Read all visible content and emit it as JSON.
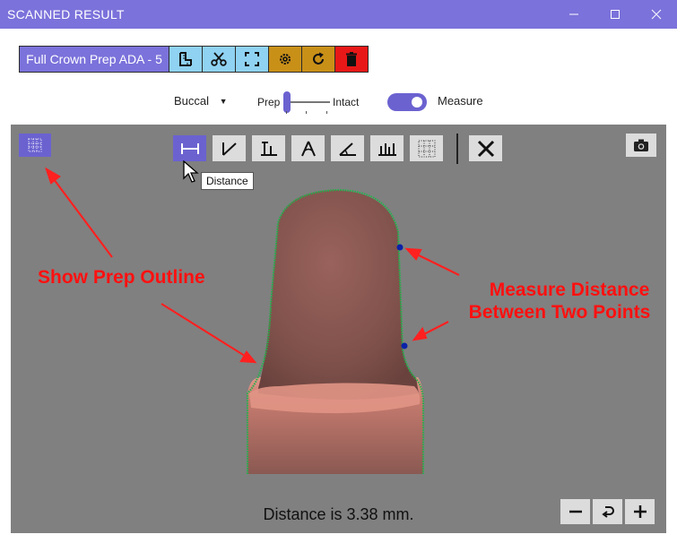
{
  "window": {
    "title": "SCANNED RESULT"
  },
  "toolbar": {
    "preset_label": "Full Crown Prep ADA - 5"
  },
  "controls": {
    "view_select": "Buccal",
    "slider_left": "Prep",
    "slider_right": "Intact",
    "slider_value": 0,
    "toggle_on": true,
    "toggle_label": "Measure"
  },
  "viewer": {
    "tooltip": "Distance",
    "status": "Distance is 3.38 mm."
  },
  "annotations": {
    "prep_outline": "Show Prep Outline",
    "measure_line1": "Measure Distance",
    "measure_line2": "Between Two Points"
  },
  "colors": {
    "accent": "#7b72db",
    "outline": "#22b14c"
  }
}
